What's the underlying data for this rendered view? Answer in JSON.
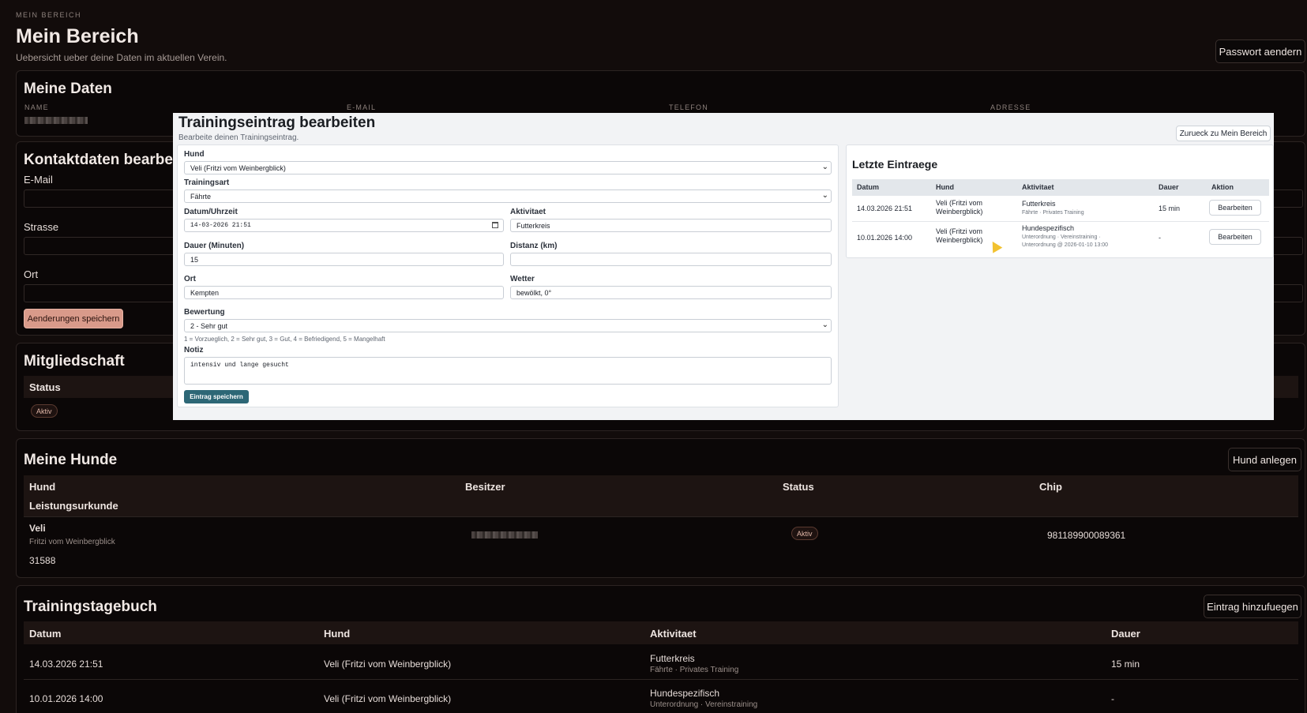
{
  "header": {
    "eyebrow": "MEIN BEREICH",
    "title": "Mein Bereich",
    "subtitle": "Uebersicht ueber deine Daten im aktuellen Verein.",
    "password_button": "Passwort aendern"
  },
  "my_data": {
    "title": "Meine Daten",
    "labels": [
      "NAME",
      "E-MAIL",
      "TELEFON",
      "ADRESSE"
    ]
  },
  "contact": {
    "title": "Kontaktdaten bearbeiten",
    "email_label": "E-Mail",
    "street_label": "Strasse",
    "city_label": "Ort",
    "save_button": "Aenderungen speichern"
  },
  "membership": {
    "title": "Mitgliedschaft",
    "status_header": "Status",
    "status_badge": "Aktiv"
  },
  "dogs": {
    "title": "Meine Hunde",
    "add_button": "Hund anlegen",
    "headers": [
      "Hund",
      "Besitzer",
      "Status",
      "Chip",
      "Leistungsurkunde"
    ],
    "rows": [
      {
        "name": "Veli",
        "full_name": "Fritzi vom Weinbergblick",
        "status": "Aktiv",
        "chip": "981189900089361",
        "certificate": "31588"
      }
    ]
  },
  "diary": {
    "title": "Trainingstagebuch",
    "add_button": "Eintrag hinzufuegen",
    "headers": [
      "Datum",
      "Hund",
      "Aktivitaet",
      "Dauer"
    ],
    "rows": [
      {
        "date": "14.03.2026 21:51",
        "dog": "Veli (Fritzi vom Weinbergblick)",
        "activity": "Futterkreis",
        "activity_sub": "Fährte · Privates Training",
        "duration": "15 min"
      },
      {
        "date": "10.01.2026 14:00",
        "dog": "Veli (Fritzi vom Weinbergblick)",
        "activity": "Hundespezifisch",
        "activity_sub": "Unterordnung · Vereinstraining",
        "duration": "-"
      }
    ]
  },
  "modal": {
    "title": "Trainingseintrag bearbeiten",
    "subtitle": "Bearbeite deinen Trainingseintrag.",
    "back_button": "Zurueck zu Mein Bereich",
    "form": {
      "dog_label": "Hund",
      "dog_value": "Veli (Fritzi vom Weinbergblick)",
      "type_label": "Trainingsart",
      "type_value": "Fährte",
      "datetime_label": "Datum/Uhrzeit",
      "datetime_value": "14-03-2026 21:51",
      "activity_label": "Aktivitaet",
      "activity_value": "Futterkreis",
      "duration_label": "Dauer (Minuten)",
      "duration_value": "15",
      "distance_label": "Distanz (km)",
      "distance_value": "",
      "place_label": "Ort",
      "place_value": "Kempten",
      "weather_label": "Wetter",
      "weather_value": "bewölkt, 0°",
      "rating_label": "Bewertung",
      "rating_value": "2 - Sehr gut",
      "rating_hint": "1 = Vorzueglich, 2 = Sehr gut, 3 = Gut, 4 = Befriedigend, 5 = Mangelhaft",
      "note_label": "Notiz",
      "note_value": "intensiv und lange gesucht",
      "save_button": "Eintrag speichern"
    },
    "recent": {
      "title": "Letzte Eintraege",
      "headers": [
        "Datum",
        "Hund",
        "Aktivitaet",
        "Dauer",
        "Aktion"
      ],
      "rows": [
        {
          "date": "14.03.2026 21:51",
          "dog_l1": "Veli (Fritzi vom",
          "dog_l2": "Weinbergblick)",
          "activity": "Futterkreis",
          "sub1": "Fährte · Privates Training",
          "sub2": "",
          "duration": "15 min",
          "action": "Bearbeiten"
        },
        {
          "date": "10.01.2026 14:00",
          "dog_l1": "Veli (Fritzi vom",
          "dog_l2": "Weinbergblick)",
          "activity": "Hundespezifisch",
          "sub1": "Unterordnung · Vereinstraining ·",
          "sub2": "Unterordnung @ 2026-01-10 13:00",
          "duration": "-",
          "action": "Bearbeiten"
        }
      ]
    }
  }
}
